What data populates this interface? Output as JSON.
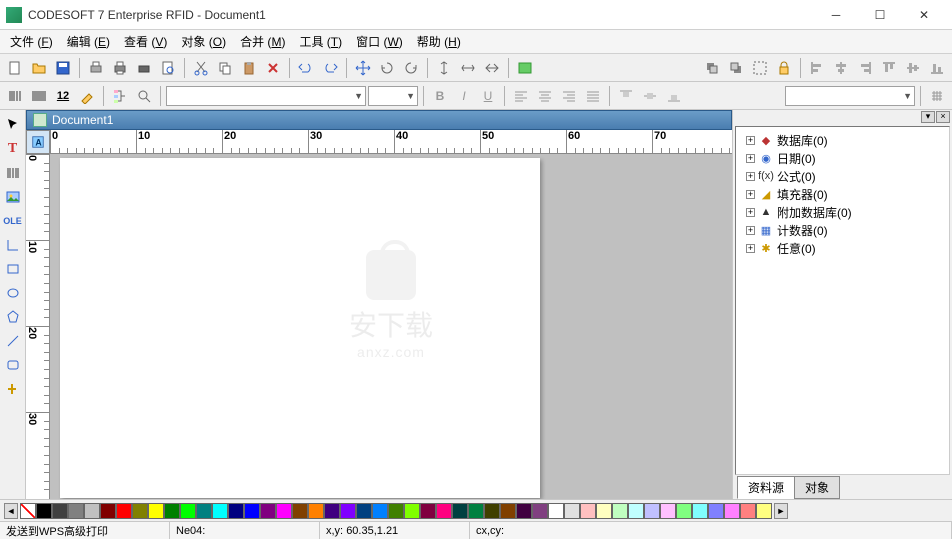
{
  "app": {
    "title": "CODESOFT 7 Enterprise RFID - Document1",
    "doc_title": "Document1"
  },
  "menus": [
    {
      "label": "文件",
      "hot": "F"
    },
    {
      "label": "编辑",
      "hot": "E"
    },
    {
      "label": "查看",
      "hot": "V"
    },
    {
      "label": "对象",
      "hot": "O"
    },
    {
      "label": "合并",
      "hot": "M"
    },
    {
      "label": "工具",
      "hot": "T"
    },
    {
      "label": "窗口",
      "hot": "W"
    },
    {
      "label": "帮助",
      "hot": "H"
    }
  ],
  "ruler_h": [
    "0",
    "10",
    "20",
    "30",
    "40",
    "50",
    "60",
    "70"
  ],
  "ruler_v": [
    "0",
    "10",
    "20",
    "30"
  ],
  "datasources": [
    {
      "icon": "db",
      "label": "数据库(0)",
      "color": "#b33"
    },
    {
      "icon": "date",
      "label": "日期(0)",
      "color": "#36c"
    },
    {
      "icon": "formula",
      "label": "公式(0)",
      "color": "#333"
    },
    {
      "icon": "fill",
      "label": "填充器(0)",
      "color": "#c90"
    },
    {
      "icon": "extdb",
      "label": "附加数据库(0)",
      "color": "#333"
    },
    {
      "icon": "counter",
      "label": "计数器(0)",
      "color": "#36c"
    },
    {
      "icon": "any",
      "label": "任意(0)",
      "color": "#c90"
    }
  ],
  "panel_tabs": {
    "t1": "资料源",
    "t2": "对象"
  },
  "status": {
    "printer": "发送到WPS高级打印",
    "port": "Ne04:",
    "coords_label": "x,y:",
    "coords_value": "60.35,1.21",
    "center_label": "cx,cy:"
  },
  "colors": [
    "#000",
    "#404040",
    "#808080",
    "#c0c0c0",
    "#800000",
    "#ff0000",
    "#808000",
    "#ffff00",
    "#008000",
    "#00ff00",
    "#008080",
    "#00ffff",
    "#000080",
    "#0000ff",
    "#800080",
    "#ff00ff",
    "#804000",
    "#ff8000",
    "#400080",
    "#8000ff",
    "#004080",
    "#0080ff",
    "#408000",
    "#80ff00",
    "#800040",
    "#ff0080",
    "#004040",
    "#008040",
    "#404000",
    "#804000",
    "#400040",
    "#804080",
    "#ffffff",
    "#e0e0e0",
    "#ffc0c0",
    "#ffffc0",
    "#c0ffc0",
    "#c0ffff",
    "#c0c0ff",
    "#ffc0ff",
    "#80ff80",
    "#80ffff",
    "#8080ff",
    "#ff80ff",
    "#ff8080",
    "#ffff80"
  ],
  "watermark": {
    "text": "安下载",
    "sub": "anxz.com"
  }
}
